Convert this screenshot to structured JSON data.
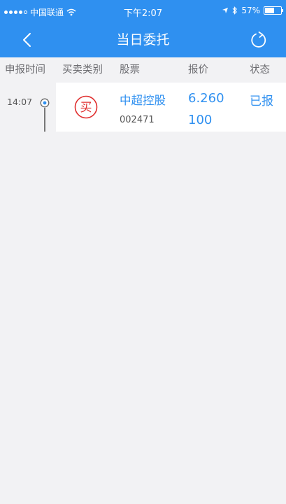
{
  "status_bar": {
    "carrier": "中国联通",
    "time": "下午2:07",
    "battery": "57%",
    "battery_level": 0.57
  },
  "navbar": {
    "title": "当日委托"
  },
  "columns": {
    "time": "申报时间",
    "type": "买卖类别",
    "stock": "股票",
    "price": "报价",
    "status": "状态"
  },
  "orders": [
    {
      "time": "14:07",
      "type": "买",
      "name": "中超控股",
      "code": "002471",
      "price": "6.260",
      "quantity": "100",
      "status": "已报"
    }
  ],
  "colors": {
    "accent": "#2f90f0",
    "buy": "#e03030"
  }
}
